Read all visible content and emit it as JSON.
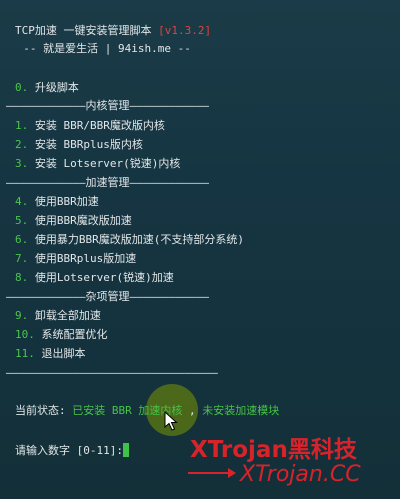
{
  "header": {
    "title": "TCP加速 一键安装管理脚本 ",
    "version": "[v1.3.2]",
    "subtitle": "  -- 就是爱生活 | 94ish.me --"
  },
  "menu": {
    "upgrade": {
      "num": "0.",
      "label": " 升级脚本"
    },
    "sep_kernel": "————————————内核管理————————————",
    "kernel_items": [
      {
        "num": "1.",
        "label": " 安装 BBR/BBR魔改版内核"
      },
      {
        "num": "2.",
        "label": " 安装 BBRplus版内核"
      },
      {
        "num": "3.",
        "label": " 安装 Lotserver(锐速)内核"
      }
    ],
    "sep_accel": "————————————加速管理————————————",
    "accel_items": [
      {
        "num": "4.",
        "label": " 使用BBR加速"
      },
      {
        "num": "5.",
        "label": " 使用BBR魔改版加速"
      },
      {
        "num": "6.",
        "label": " 使用暴力BBR魔改版加速(不支持部分系统)"
      },
      {
        "num": "7.",
        "label": " 使用BBRplus版加速"
      },
      {
        "num": "8.",
        "label": " 使用Lotserver(锐速)加速"
      }
    ],
    "sep_misc": "————————————杂项管理————————————",
    "misc_items": [
      {
        "num": "9.",
        "label": " 卸载全部加速"
      },
      {
        "num": "10.",
        "label": " 系统配置优化"
      },
      {
        "num": "11.",
        "label": " 退出脚本"
      }
    ],
    "sep_end": "————————————————————————————————"
  },
  "status": {
    "label": "当前状态: ",
    "installed": "已安装 BBR 加速内核",
    "comma": " , ",
    "not_installed": "未安装加速模块"
  },
  "prompt": {
    "text": "请输入数字 [0-11]:"
  },
  "watermark": {
    "line1": "XTrojan黑科技",
    "line2": "XTrojan.CC"
  },
  "colors": {
    "background": "#163542",
    "number_green": "#4cc54c",
    "version_red": "#e0433f",
    "watermark_red": "#d9232a",
    "cursor_green": "#3fc14a"
  }
}
